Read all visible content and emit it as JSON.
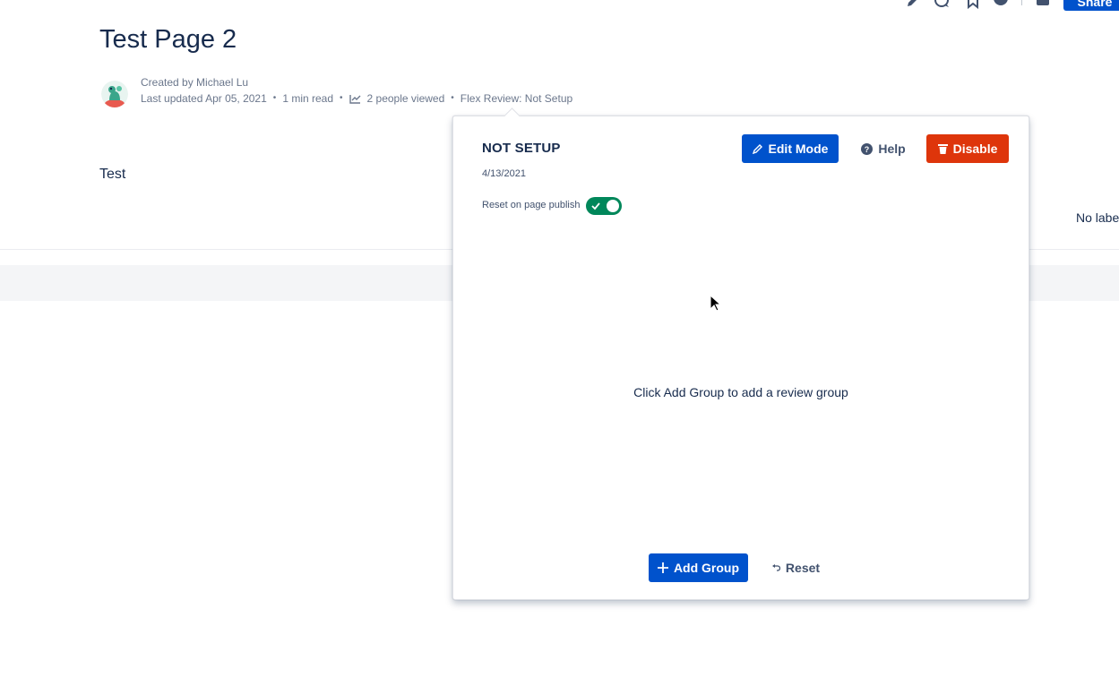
{
  "toolbar": {
    "share_label": "Share",
    "icons": [
      "edit-icon",
      "comment-icon",
      "star-icon",
      "watch-icon",
      "archive-icon"
    ]
  },
  "page": {
    "title": "Test Page 2",
    "created_by": "Created by Michael Lu",
    "last_updated": "Last updated Apr 05, 2021",
    "read_time": "1 min read",
    "views": "2 people viewed",
    "flex_review": "Flex Review: Not Setup",
    "body_text": "Test",
    "labels_text": "No labe"
  },
  "popup": {
    "status_title": "NOT SETUP",
    "status_date": "4/13/2021",
    "reset_on_publish_label": "Reset on page publish",
    "reset_on_publish_enabled": true,
    "edit_mode_label": "Edit Mode",
    "help_label": "Help",
    "disable_label": "Disable",
    "empty_message": "Click Add Group to add a review group",
    "add_group_label": "Add Group",
    "reset_label": "Reset"
  },
  "colors": {
    "primary": "#0052cc",
    "danger": "#de350b",
    "success": "#00875a",
    "text": "#172b4d",
    "subtle": "#6b778c"
  }
}
